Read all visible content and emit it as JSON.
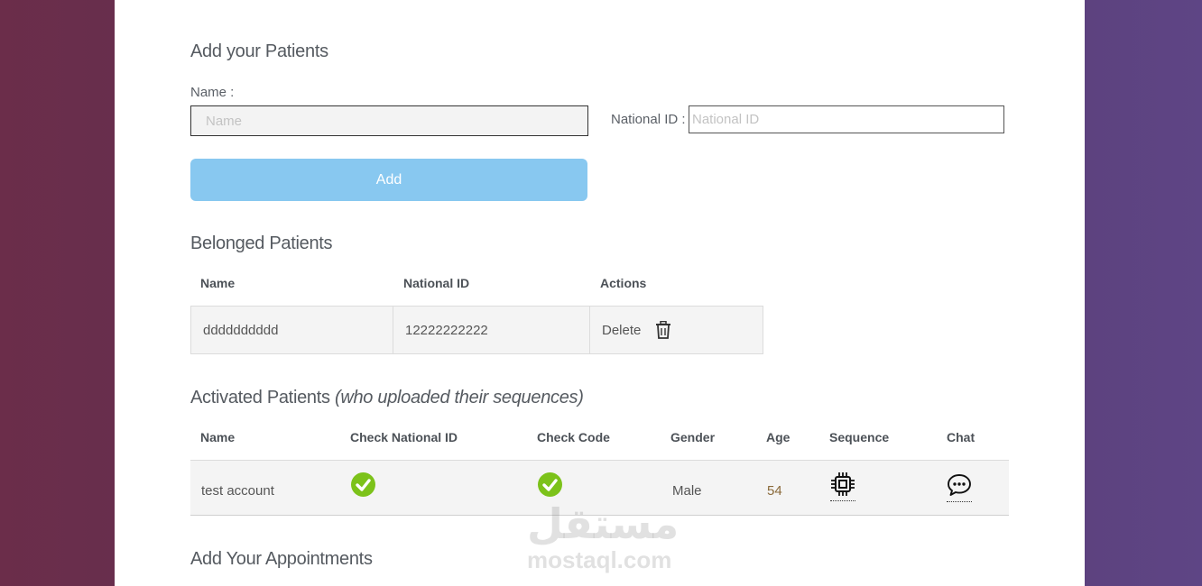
{
  "add_patients": {
    "heading": "Add your Patients",
    "name_label": "Name :",
    "name_placeholder": "Name",
    "national_id_label": "National ID :",
    "national_id_placeholder": "National ID",
    "add_button": "Add"
  },
  "belonged": {
    "heading": "Belonged Patients",
    "columns": [
      "Name",
      "National ID",
      "Actions"
    ],
    "rows": [
      {
        "name": "dddddddddd",
        "national_id": "12222222222",
        "action": "Delete",
        "action_icon": "trash-icon"
      }
    ]
  },
  "activated": {
    "heading": "Activated Patients",
    "heading_note": "(who uploaded their sequences)",
    "columns": [
      "Name",
      "Check National ID",
      "Check Code",
      "Gender",
      "Age",
      "Sequence",
      "Chat"
    ],
    "rows": [
      {
        "name": "test account",
        "check_national_id": "check-icon",
        "check_code": "check-icon",
        "gender": "Male",
        "age": "54",
        "sequence_icon": "chip-icon",
        "chat_icon": "chat-icon"
      }
    ]
  },
  "appointments": {
    "heading": "Add Your Appointments"
  },
  "watermark": {
    "arabic": "مستقل",
    "latin": "mostaql.com"
  },
  "colors": {
    "add_button": "#88c8f0",
    "check": "#7cc21a",
    "row_background": "#f4f4f4"
  }
}
